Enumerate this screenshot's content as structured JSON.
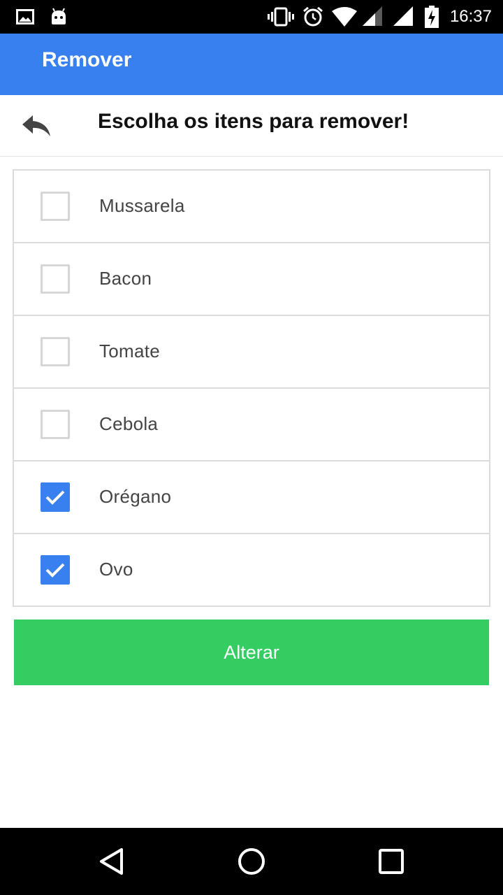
{
  "status_bar": {
    "time": "16:37",
    "icons": [
      "gallery-icon",
      "android-icon",
      "vibrate-icon",
      "alarm-icon",
      "wifi-icon",
      "signal-icon",
      "signal-icon",
      "battery-charging-icon"
    ]
  },
  "app_bar": {
    "title": "Remover"
  },
  "header": {
    "back_icon": "reply-arrow-icon",
    "title": "Escolha os itens para remover!"
  },
  "items": [
    {
      "label": "Mussarela",
      "checked": false
    },
    {
      "label": "Bacon",
      "checked": false
    },
    {
      "label": "Tomate",
      "checked": false
    },
    {
      "label": "Cebola",
      "checked": false
    },
    {
      "label": "Orégano",
      "checked": true
    },
    {
      "label": "Ovo",
      "checked": true
    }
  ],
  "actions": {
    "submit_label": "Alterar"
  },
  "nav_bar": {
    "icons": [
      "back-triangle-icon",
      "home-circle-icon",
      "recents-square-icon"
    ]
  },
  "colors": {
    "primary": "#3880f0",
    "button": "#34cd61",
    "checkbox_border": "#d6d6d6"
  }
}
